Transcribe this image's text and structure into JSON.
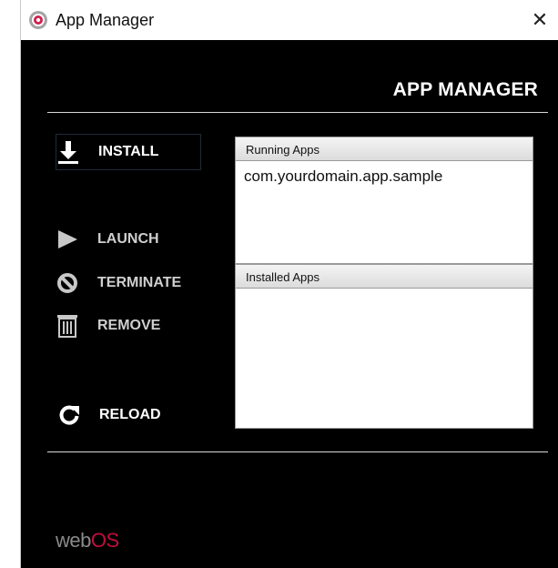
{
  "window": {
    "title": "App Manager",
    "close_glyph": "✕"
  },
  "header": {
    "title": "APP MANAGER"
  },
  "commands": [
    {
      "label": "INSTALL",
      "icon": "download-icon"
    },
    {
      "label": "LAUNCH",
      "icon": "play-icon"
    },
    {
      "label": "TERMINATE",
      "icon": "prohibit-icon"
    },
    {
      "label": "REMOVE",
      "icon": "trash-icon"
    },
    {
      "label": "RELOAD",
      "icon": "reload-icon"
    }
  ],
  "running_apps": {
    "header": "Running Apps",
    "items": [
      "com.yourdomain.app.sample"
    ]
  },
  "installed_apps": {
    "header": "Installed Apps",
    "items": []
  },
  "logo": {
    "web": "web",
    "os": "OS"
  },
  "colors": {
    "background": "#000000",
    "text_primary": "#ffffff",
    "logo_accent": "#c30d3c",
    "logo_gray": "#8a8a8a"
  }
}
